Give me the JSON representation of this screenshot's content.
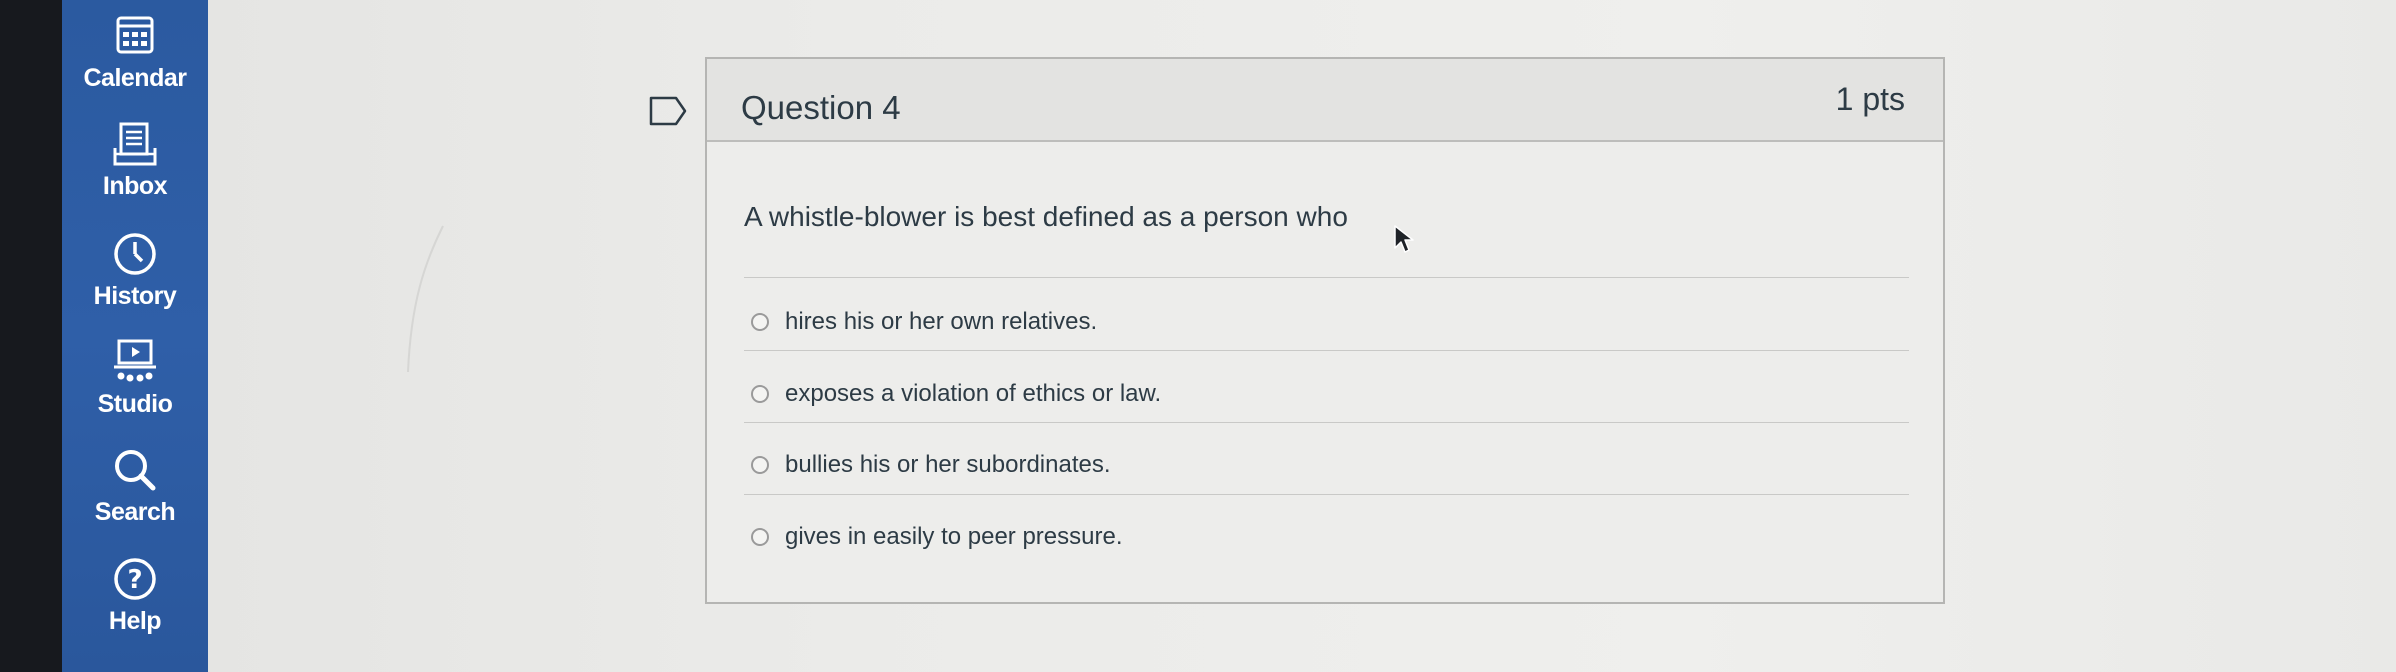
{
  "nav": {
    "calendar": "Calendar",
    "inbox": "Inbox",
    "history": "History",
    "studio": "Studio",
    "search": "Search",
    "help": "Help"
  },
  "question": {
    "title": "Question 4",
    "points": "1 pts",
    "text": "A whistle-blower is best defined as a person who",
    "answers": [
      "hires his or her own relatives.",
      "exposes a violation of ethics or law.",
      "bullies his or her subordinates.",
      "gives in easily to peer pressure."
    ]
  },
  "colors": {
    "sidebar": "#2f5fa8",
    "text": "#2d3b45",
    "card_border": "#b5b5b3"
  },
  "icons": [
    "calendar-icon",
    "inbox-icon",
    "clock-icon",
    "studio-icon",
    "search-icon",
    "help-icon",
    "bookmark-flag-icon",
    "mouse-cursor-icon"
  ]
}
